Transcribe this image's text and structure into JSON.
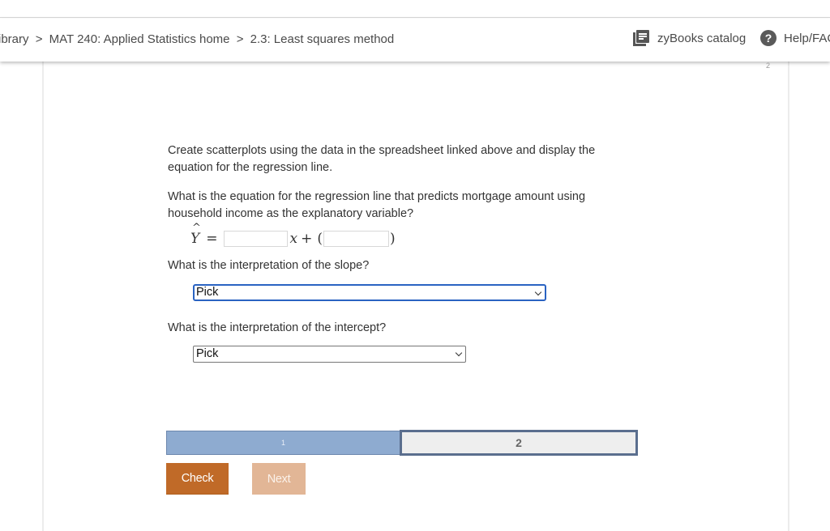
{
  "header": {
    "breadcrumb": [
      "ibrary",
      "MAT 240: Applied Statistics home",
      "2.3: Least squares method"
    ],
    "breadcrumb_separator": ">",
    "catalog_label": "zyBooks catalog",
    "help_label": "Help/FAC"
  },
  "page_indicator": "2",
  "question": {
    "intro": "Create scatterplots using the data in the spreadsheet linked above and display the equation for the regression line.",
    "prompt": "What is the equation for the regression line that predicts mortgage amount using household income as the explanatory variable?",
    "equation": {
      "lhs": "Y",
      "equals": "=",
      "x_symbol": "x",
      "plus": "+",
      "open_paren": "(",
      "close_paren": ")",
      "slope_value": "",
      "intercept_value": ""
    },
    "slope_label": "What is the interpretation of the slope?",
    "slope_select_value": "Pick",
    "intercept_label": "What is the interpretation of the intercept?",
    "intercept_select_value": "Pick"
  },
  "progress": {
    "steps": [
      "1",
      "2"
    ],
    "current_step": 2
  },
  "buttons": {
    "check": "Check",
    "next": "Next"
  }
}
